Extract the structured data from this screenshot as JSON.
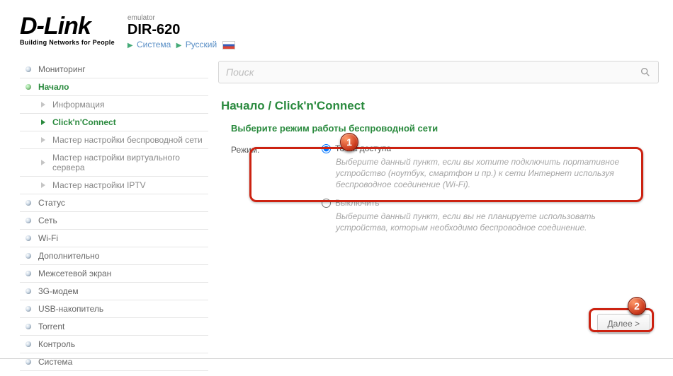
{
  "logo": {
    "name": "D-Link",
    "tagline": "Building Networks for People"
  },
  "header": {
    "emulator": "emulator",
    "model": "DIR-620"
  },
  "breadcrumb": {
    "system": "Система",
    "language": "Русский"
  },
  "search": {
    "placeholder": "Поиск"
  },
  "sidebar": {
    "items": [
      {
        "label": "Мониторинг",
        "type": "top"
      },
      {
        "label": "Начало",
        "type": "top",
        "active": true
      },
      {
        "label": "Информация",
        "type": "sub"
      },
      {
        "label": "Click'n'Connect",
        "type": "sub",
        "active": true
      },
      {
        "label": "Мастер настройки беспроводной сети",
        "type": "sub"
      },
      {
        "label": "Мастер настройки виртуального сервера",
        "type": "sub"
      },
      {
        "label": "Мастер настройки IPTV",
        "type": "sub"
      },
      {
        "label": "Статус",
        "type": "top"
      },
      {
        "label": "Сеть",
        "type": "top"
      },
      {
        "label": "Wi-Fi",
        "type": "top"
      },
      {
        "label": "Дополнительно",
        "type": "top"
      },
      {
        "label": "Межсетевой экран",
        "type": "top"
      },
      {
        "label": "3G-модем",
        "type": "top"
      },
      {
        "label": "USB-накопитель",
        "type": "top"
      },
      {
        "label": "Torrent",
        "type": "top"
      },
      {
        "label": "Контроль",
        "type": "top"
      },
      {
        "label": "Система",
        "type": "top"
      }
    ]
  },
  "main": {
    "breadcrumb": "Начало /  Click'n'Connect",
    "section": "Выберите режим работы беспроводной сети",
    "mode_label": "Режим:",
    "opt1": {
      "label": "Точка доступа",
      "desc": "Выберите данный пункт, если вы хотите подключить портативное устройство (ноутбук, смартфон и пр.) к сети Интернет используя беспроводное соединение (Wi-Fi)."
    },
    "opt2": {
      "label": "Выключить",
      "desc": "Выберите данный пункт, если вы не планируете использовать устройства, которым необходимо беспроводное соединение."
    },
    "next": "Далее >"
  },
  "annotations": {
    "n1": "1",
    "n2": "2"
  }
}
